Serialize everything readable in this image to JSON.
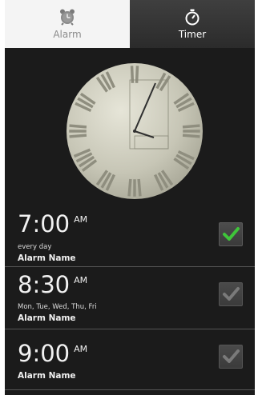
{
  "tabs": [
    {
      "label": "Alarm",
      "icon": "alarm-clock-icon",
      "selected": true
    },
    {
      "label": "Timer",
      "icon": "stopwatch-icon",
      "selected": false
    }
  ],
  "clock": {
    "hour": 1,
    "minute": 56,
    "style": "roman-numerals"
  },
  "alarms": [
    {
      "time": "7:00",
      "ampm": "AM",
      "days": "every day",
      "name": "Alarm Name",
      "enabled": true
    },
    {
      "time": "8:30",
      "ampm": "AM",
      "days": "Mon, Tue, Wed, Thu, Fri",
      "name": "Alarm Name",
      "enabled": false
    },
    {
      "time": "9:00",
      "ampm": "AM",
      "days": "",
      "name": "Alarm Name",
      "enabled": false
    }
  ],
  "colors": {
    "check_on": "#3fc53a",
    "check_off": "#7a7a7a",
    "clock_face": "#c9c8b8"
  }
}
